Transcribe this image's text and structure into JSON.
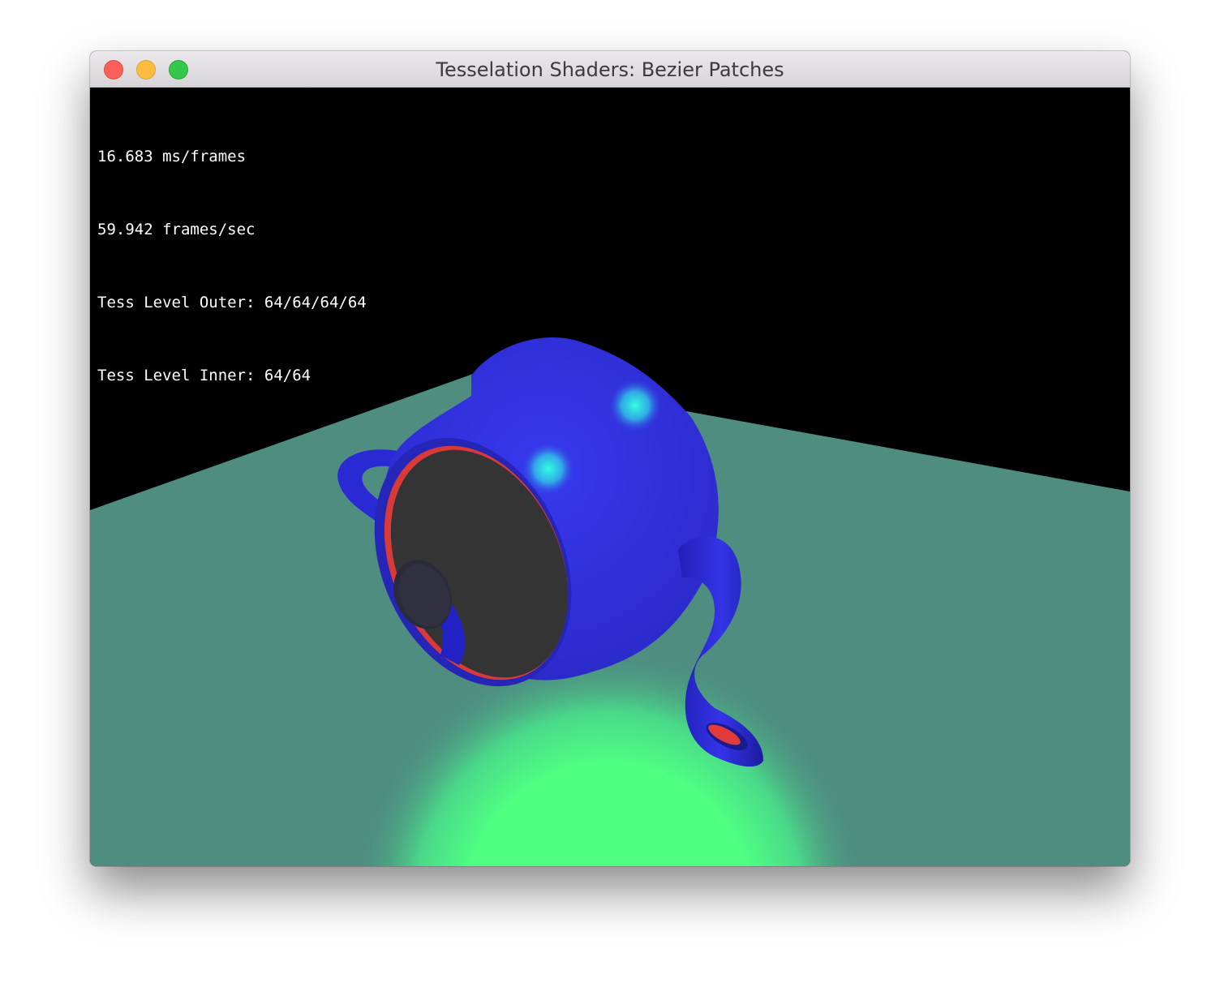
{
  "window": {
    "title": "Tesselation Shaders: Bezier Patches"
  },
  "stats": {
    "ms_per_frame": "16.683 ms/frames",
    "fps": "59.942 frames/sec",
    "tess_outer": "Tess Level Outer: 64/64/64/64",
    "tess_inner": "Tess Level Inner: 64/64"
  },
  "scene": {
    "subject": "teapot",
    "colors": {
      "background": "#000000",
      "floor": "#4e8d80",
      "floor_glow": "#4fff7f",
      "teapot": "#2f2fdc",
      "teapot_specular": "#2fffd0",
      "teapot_inner": "#d83a3a",
      "lid_face": "#333333"
    }
  }
}
